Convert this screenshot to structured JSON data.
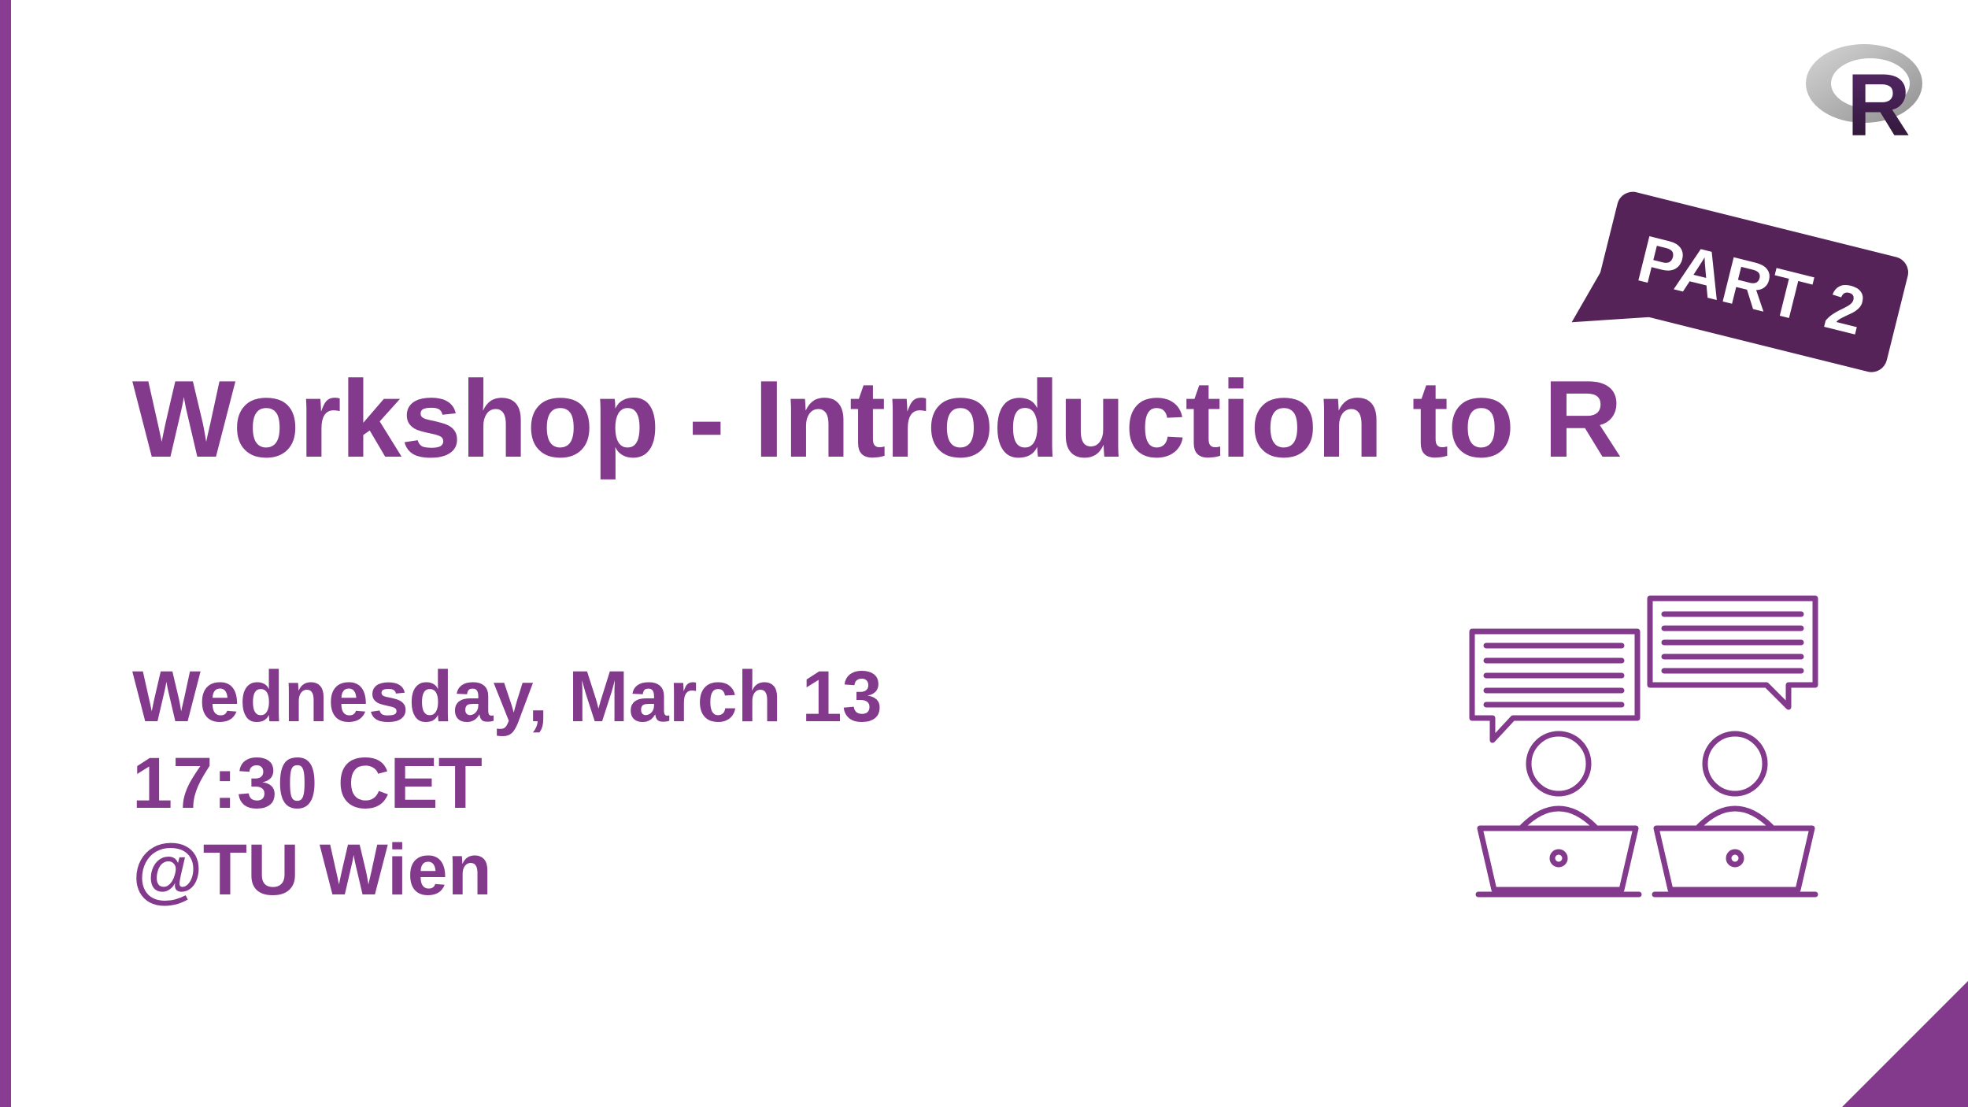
{
  "slide": {
    "title": "Workshop - Introduction to R",
    "badge_text": "PART 2",
    "details": [
      "Wednesday, March 13",
      "17:30 CET",
      "@TU Wien"
    ],
    "logo_letter": "R",
    "illustration_icon": "two-people-laptops-chat-icon"
  },
  "colors": {
    "accent": "#833a8c",
    "badge": "#562358",
    "logo_ring": "#b3b3b3",
    "logo_letter": "#3d1e4b"
  }
}
